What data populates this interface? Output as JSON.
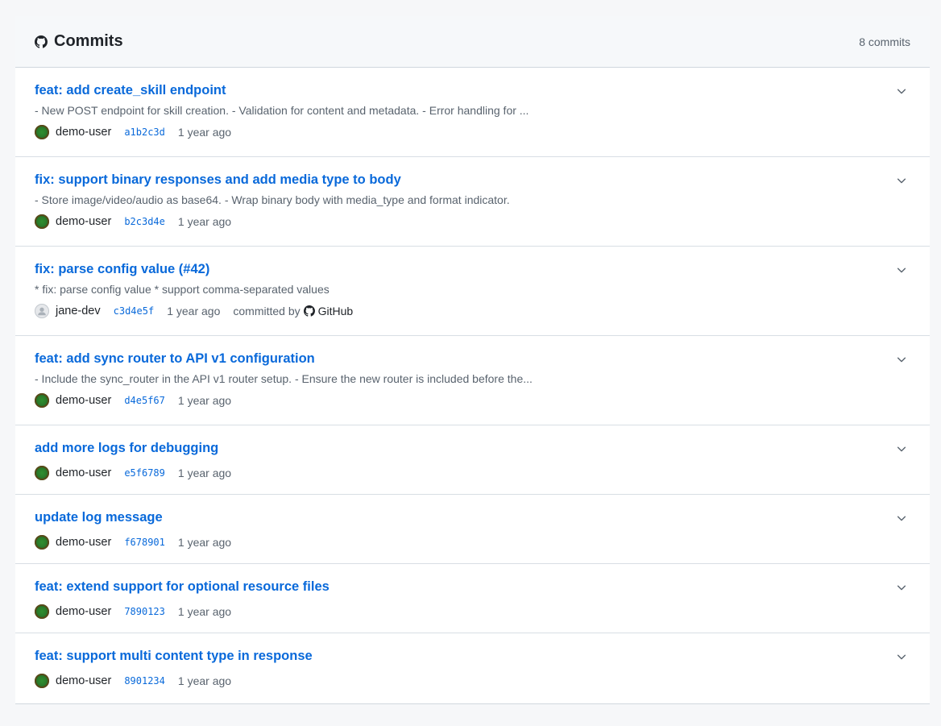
{
  "header": {
    "title": "Commits",
    "count_label": "8 commits"
  },
  "commits": [
    {
      "title": "feat: add create_skill endpoint",
      "description": "- New POST endpoint for skill creation. - Validation for content and metadata. - Error handling for ...",
      "author": "demo-user",
      "sha": "a1b2c3d",
      "time": "1 year ago"
    },
    {
      "title": "fix: support binary responses and add media type to body",
      "description": "- Store image/video/audio as base64. - Wrap binary body with media_type and format indicator.",
      "author": "demo-user",
      "sha": "b2c3d4e",
      "time": "1 year ago"
    },
    {
      "title": "fix: parse config value (#42)",
      "description": "* fix: parse config value * support comma-separated values",
      "author": "jane-dev",
      "sha": "c3d4e5f",
      "time": "1 year ago",
      "committed_by_label": "committed by",
      "committer": "GitHub"
    },
    {
      "title": "feat: add sync router to API v1 configuration",
      "description": "- Include the sync_router in the API v1 router setup. - Ensure the new router is included before the...",
      "author": "demo-user",
      "sha": "d4e5f67",
      "time": "1 year ago"
    },
    {
      "title": "add more logs for debugging",
      "author": "demo-user",
      "sha": "e5f6789",
      "time": "1 year ago"
    },
    {
      "title": "update log message",
      "author": "demo-user",
      "sha": "f678901",
      "time": "1 year ago"
    },
    {
      "title": "feat: extend support for optional resource files",
      "author": "demo-user",
      "sha": "7890123",
      "time": "1 year ago"
    },
    {
      "title": "feat: support multi content type in response",
      "author": "demo-user",
      "sha": "8901234",
      "time": "1 year ago"
    }
  ],
  "colors": {
    "link": "#0969da",
    "muted": "#59636e",
    "text": "#1f2328",
    "header_bg": "#f6f8fa",
    "page_bg": "#f6f7f9"
  },
  "icons": {
    "header": "github-icon",
    "expand": "chevron-down-icon",
    "avatar_default": "user-avatar-icon"
  }
}
